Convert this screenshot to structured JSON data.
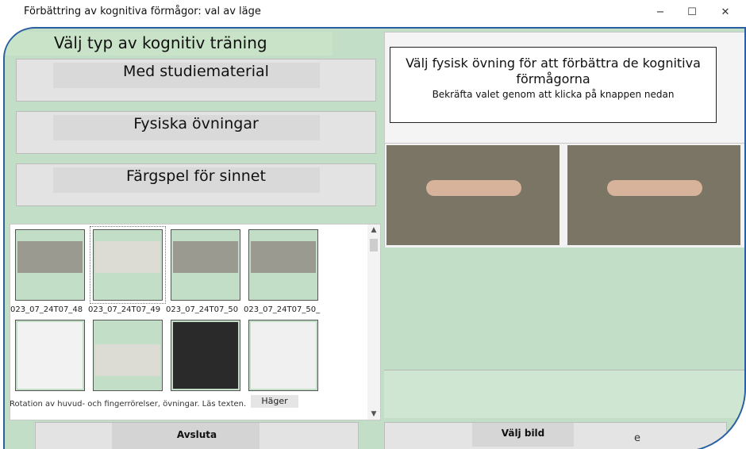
{
  "window": {
    "title": "Förbättring av kognitiva förmågor: val av läge",
    "minimize": "−",
    "maximize": "☐",
    "close": "✕"
  },
  "left": {
    "heading": "Välj typ av kognitiv träning",
    "modes": [
      {
        "label": "Med studiematerial"
      },
      {
        "label": "Fysiska övningar"
      },
      {
        "label": "Färgspel för sinnet"
      }
    ],
    "gallery": {
      "captions": [
        "023_07_24T07_48",
        "023_07_24T07_49",
        "023_07_24T07_50",
        "023_07_24T07_50_"
      ],
      "description": "Rotation av huvud- och fingerrörelser, övningar. Läs texten.",
      "hager": "Häger",
      "scroll_up": "▲",
      "scroll_down": "▼"
    },
    "exit_label": "Avsluta"
  },
  "right": {
    "info_title": "Välj fysisk övning för att förbättra de kognitiva förmågorna",
    "info_sub": "Bekräfta valet genom att klicka på knappen nedan",
    "select_label": "Välj bild",
    "select_extra": "e"
  },
  "colors": {
    "green": "#c2dec7",
    "frame_border": "#2a5fa0"
  }
}
